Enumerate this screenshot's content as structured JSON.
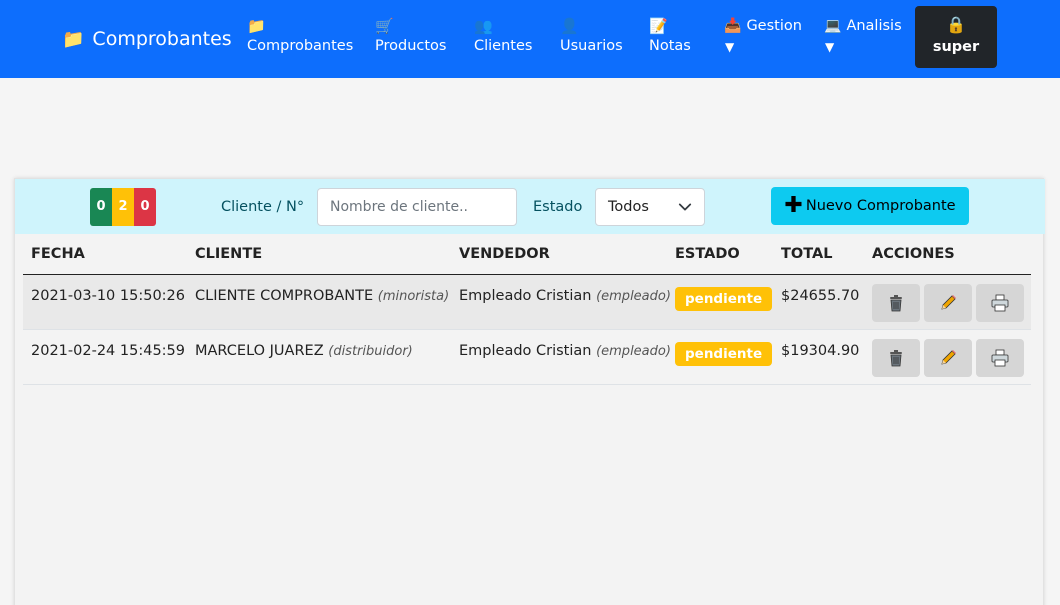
{
  "navbar": {
    "brand": {
      "label": "Comprobantes",
      "icon": "folder-icon"
    },
    "items": [
      {
        "label": "Comprobantes",
        "icon": "folder-icon"
      },
      {
        "label": "Productos",
        "icon": "cart-icon"
      },
      {
        "label": "Clientes",
        "icon": "people-icon"
      },
      {
        "label": "Usuarios",
        "icon": "user-icon"
      },
      {
        "label": "Notas",
        "icon": "memo-icon"
      }
    ],
    "dropdowns": [
      {
        "label": "Gestion",
        "icon": "inbox-tray-icon",
        "caret": "▼"
      },
      {
        "label": "Analisis",
        "icon": "laptop-icon",
        "caret": "▼"
      }
    ],
    "user": {
      "label": "super",
      "icon": "lock-icon"
    }
  },
  "toolbar": {
    "counters": {
      "green": "0",
      "yellow": "2",
      "red": "0"
    },
    "cliente_label": "Cliente / N°",
    "cliente_placeholder": "Nombre de cliente..",
    "estado_label": "Estado",
    "estado_value": "Todos",
    "new_button": "Nuevo Comprobante"
  },
  "table": {
    "headers": {
      "fecha": "FECHA",
      "cliente": "CLIENTE",
      "vendedor": "VENDEDOR",
      "estado": "ESTADO",
      "total": "TOTAL",
      "acciones": "ACCIONES"
    },
    "rows": [
      {
        "fecha": "2021-03-10 15:50:26",
        "cliente": "CLIENTE COMPROBANTE",
        "cliente_tipo": "(minorista)",
        "vendedor": "Empleado Cristian",
        "vendedor_tipo": "(empleado)",
        "estado": "pendiente",
        "total": "$24655.70"
      },
      {
        "fecha": "2021-02-24 15:45:59",
        "cliente": "MARCELO JUAREZ",
        "cliente_tipo": "(distribuidor)",
        "vendedor": "Empleado Cristian",
        "vendedor_tipo": "(empleado)",
        "estado": "pendiente",
        "total": "$19304.90"
      }
    ],
    "actions": [
      "trash-icon",
      "pencil-icon",
      "printer-icon"
    ]
  },
  "colors": {
    "navbar": "#0d6efd",
    "toolbar": "#cff4fc",
    "info_button": "#0dcaf0",
    "badge": "#ffc107",
    "green": "#198754",
    "red": "#dc3545"
  }
}
